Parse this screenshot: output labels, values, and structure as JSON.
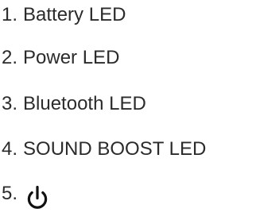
{
  "legend": {
    "items": [
      {
        "number": "1.",
        "label": "Battery LED"
      },
      {
        "number": "2.",
        "label": "Power LED"
      },
      {
        "number": "3.",
        "label": "Bluetooth LED"
      },
      {
        "number": "4.",
        "label": "SOUND BOOST LED"
      },
      {
        "number": "5.",
        "icon": "power-icon"
      }
    ]
  },
  "colors": {
    "text": "#2b2b2b",
    "background": "#ffffff"
  }
}
